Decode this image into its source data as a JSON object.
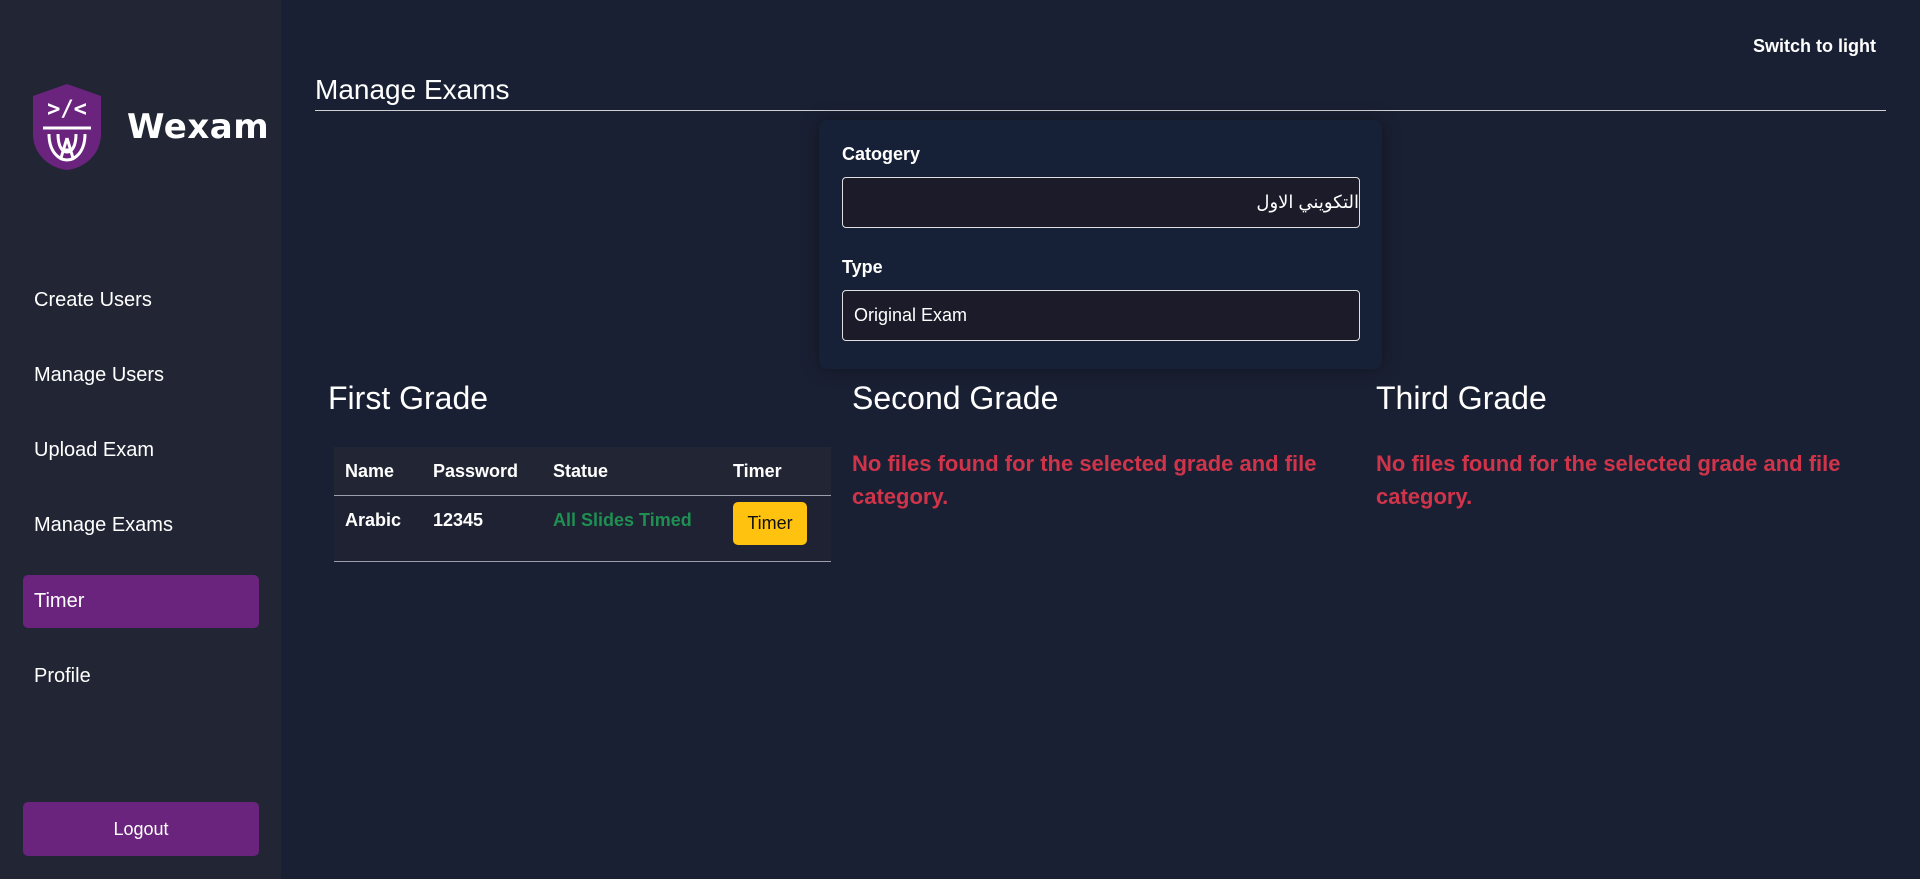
{
  "sidebar": {
    "brand": "Wexam",
    "logo_icon": "wexam-code-shield-logo",
    "nav": [
      {
        "label": "Create Users",
        "active": false
      },
      {
        "label": "Manage Users",
        "active": false
      },
      {
        "label": "Upload Exam",
        "active": false
      },
      {
        "label": "Manage Exams",
        "active": false
      },
      {
        "label": "Timer",
        "active": true
      },
      {
        "label": "Profile",
        "active": false
      }
    ],
    "logout_label": "Logout"
  },
  "header": {
    "theme_toggle": "Switch to light",
    "page_title": "Manage Exams"
  },
  "filters": {
    "category_label": "Catogery",
    "category_value": "التكويني الاول",
    "type_label": "Type",
    "type_value": "Original Exam"
  },
  "grades": {
    "first": {
      "heading": "First Grade",
      "columns": [
        "Name",
        "Password",
        "Statue",
        "Timer"
      ],
      "rows": [
        {
          "name": "Arabic",
          "password": "12345",
          "status": "All Slides Timed",
          "action": "Timer"
        }
      ]
    },
    "second": {
      "heading": "Second Grade",
      "message": "No files found for the selected grade and file category."
    },
    "third": {
      "heading": "Third Grade",
      "message": "No files found for the selected grade and file category."
    }
  },
  "colors": {
    "background": "#1a2033",
    "sidebar": "#222634",
    "accent_purple": "#6a247d",
    "error_red": "#d0344a",
    "success_green": "#1f8f52",
    "timer_yellow": "#ffc20e"
  }
}
